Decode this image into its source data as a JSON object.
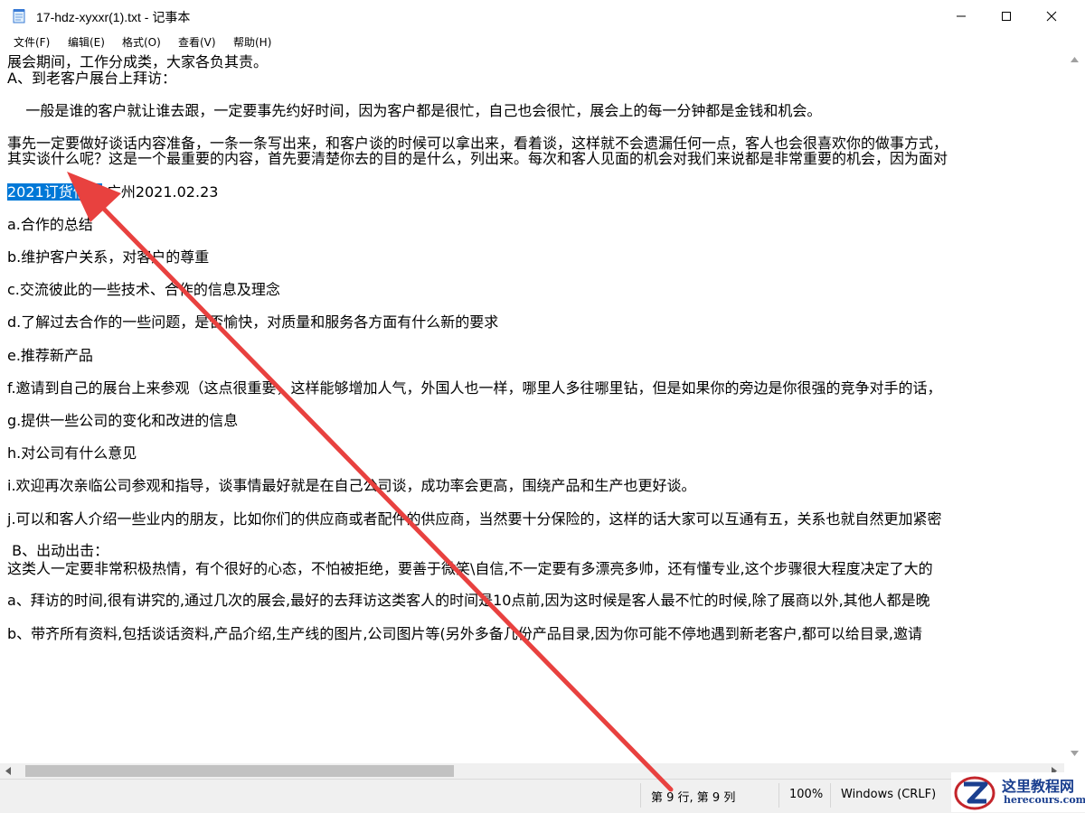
{
  "window": {
    "title": "17-hdz-xyxxr(1).txt - 记事本"
  },
  "menu": {
    "items": [
      {
        "label": "文件(F)"
      },
      {
        "label": "编辑(E)"
      },
      {
        "label": "格式(O)"
      },
      {
        "label": "查看(V)"
      },
      {
        "label": "帮助(H)"
      }
    ]
  },
  "editor": {
    "lines": [
      "展会期间，工作分成类，大家各负其责。",
      "A、到老客户展台上拜访：",
      "    一般是谁的客户就让谁去跟，一定要事先约好时间，因为客户都是很忙，自己也会很忙，展会上的每一分钟都是金钱和机会。",
      "事先一定要做好谈话内容准备，一条一条写出来，和客户谈的时候可以拿出来，看着谈，这样就不会遗漏任何一点，客人也会很喜欢你的做事方式，",
      "其实谈什么呢？这是一个最重要的内容，首先要清楚你去的目的是什么，列出来。每次和客人见面的机会对我们来说都是非常重要的机会，因为面对",
      "a.合作的总结",
      "b.维护客户关系，对客户的尊重",
      "c.交流彼此的一些技术、合作的信息及理念",
      "d.了解过去合作的一些问题，是否愉快，对质量和服务各方面有什么新的要求",
      "e.推荐新产品",
      "f.邀请到自己的展台上来参观（这点很重要，这样能够增加人气，外国人也一样，哪里人多往哪里钻，但是如果你的旁边是你很强的竞争对手的话，",
      "g.提供一些公司的变化和改进的信息",
      "h.对公司有什么意见",
      "i.欢迎再次亲临公司参观和指导，谈事情最好就是在自己公司谈，成功率会更高，围绕产品和生产也更好谈。",
      "j.可以和客人介绍一些业内的朋友，比如你们的供应商或者配件的供应商，当然要十分保险的，这样的话大家可以互通有五，关系也就自然更加紧密",
      " B、出动出击：",
      "这类人一定要非常积极热情，有个很好的心态，不怕被拒绝，要善于微笑\\自信,不一定要有多漂亮多帅，还有懂专业,这个步骤很大程度决定了大的",
      "a、拜访的时间,很有讲究的,通过几次的展会,最好的去拜访这类客人的时间是10点前,因为这时候是客人最不忙的时候,除了展商以外,其他人都是晚",
      "b、带齐所有资料,包括谈话资料,产品介绍,生产线的图片,公司图片等(另外多备几份产品目录,因为你可能不停地遇到新老客户,都可以给目录,邀请"
    ],
    "selected_line": {
      "selected_text": "2021订货信息",
      "rest_text": " 广州2021.02.23"
    }
  },
  "statusbar": {
    "position": "第 9 行, 第 9 列",
    "zoom": "100%",
    "line_ending": "Windows (CRLF)"
  },
  "watermark": {
    "title": "这里教程网",
    "url": "herecours.com"
  },
  "colors": {
    "selection": "#0078d7",
    "arrow": "#e8413f"
  }
}
